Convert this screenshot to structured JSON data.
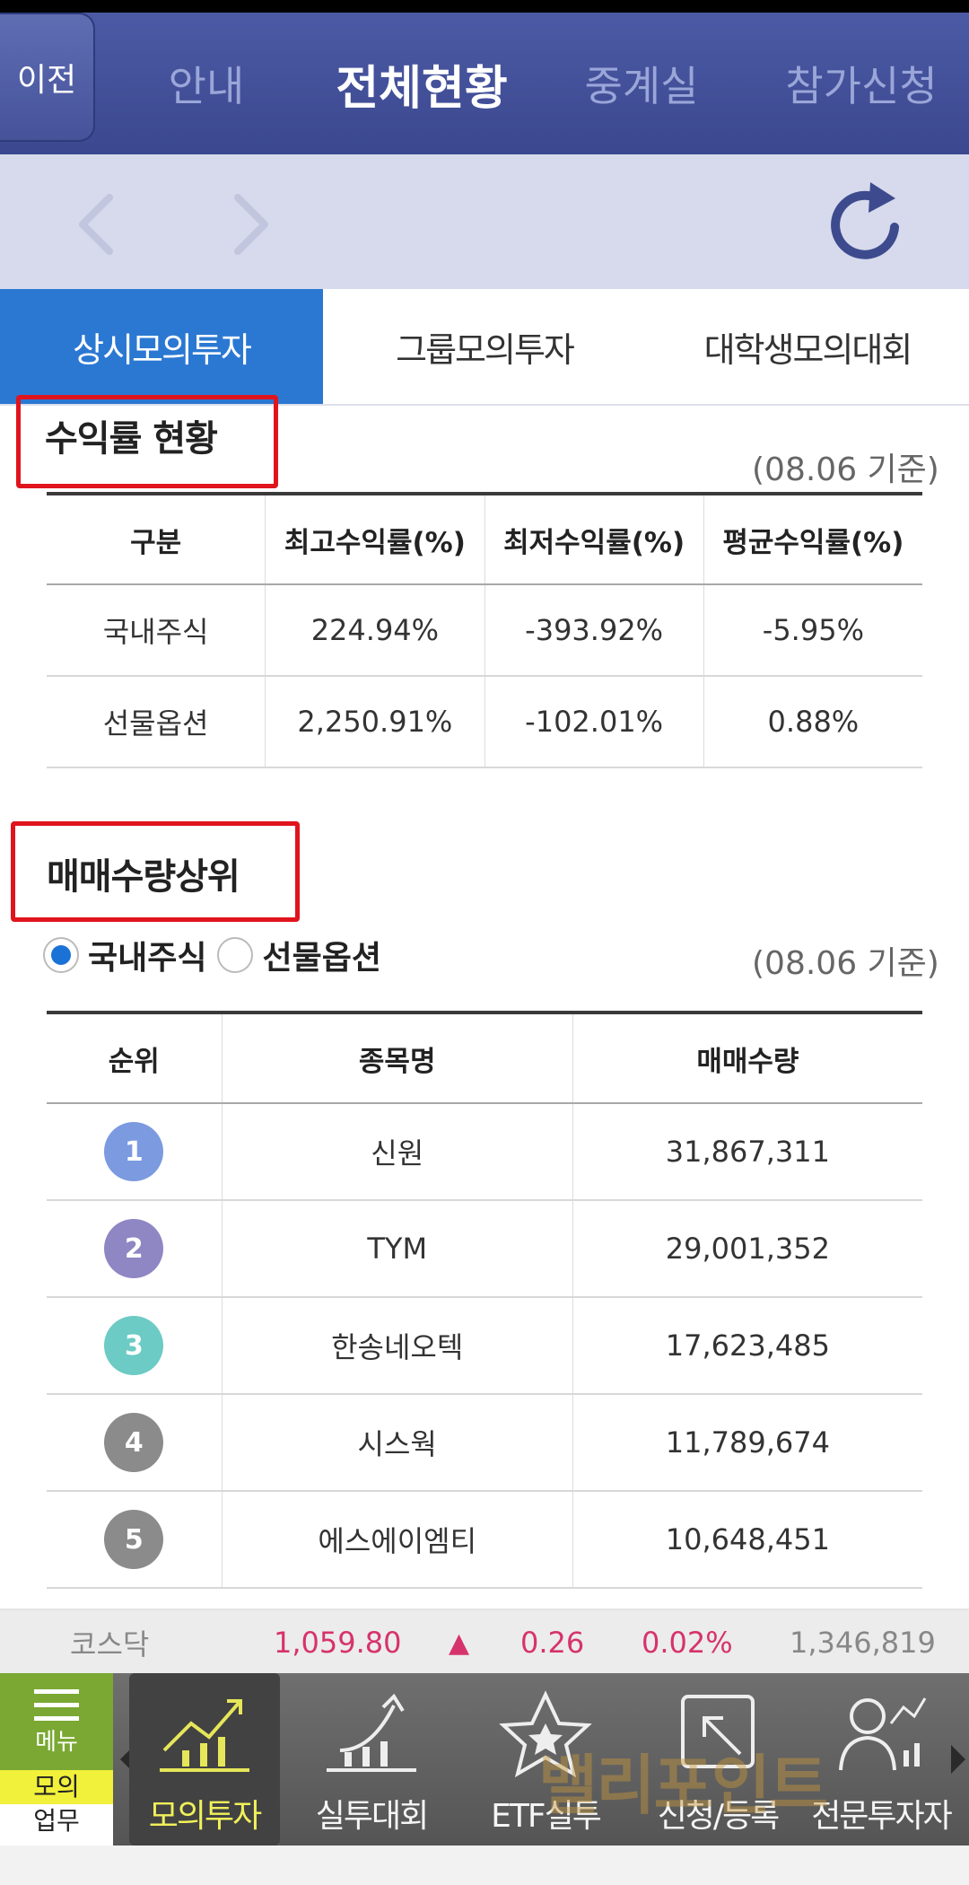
{
  "topnav": {
    "back_label": "이전",
    "tabs": [
      {
        "label": "안내"
      },
      {
        "label": "전체현황"
      },
      {
        "label": "중계실"
      },
      {
        "label": "참가신청"
      }
    ]
  },
  "subtabs": [
    {
      "label": "상시모의투자"
    },
    {
      "label": "그룹모의투자"
    },
    {
      "label": "대학생모의대회"
    }
  ],
  "returns": {
    "title": "수익률 현황",
    "basis": "(08.06 기준)",
    "headers": [
      "구분",
      "최고수익률(%)",
      "최저수익률(%)",
      "평균수익률(%)"
    ],
    "rows": [
      [
        "국내주식",
        "224.94%",
        "-393.92%",
        "-5.95%"
      ],
      [
        "선물옵션",
        "2,250.91%",
        "-102.01%",
        "0.88%"
      ]
    ]
  },
  "volume": {
    "title": "매매수량상위",
    "basis": "(08.06 기준)",
    "radio": [
      {
        "label": "국내주식",
        "selected": true
      },
      {
        "label": "선물옵션",
        "selected": false
      }
    ],
    "headers": [
      "순위",
      "종목명",
      "매매수량"
    ],
    "rows": [
      {
        "rank": "1",
        "name": "신원",
        "qty": "31,867,311",
        "color": "#7b9ae0"
      },
      {
        "rank": "2",
        "name": "TYM",
        "qty": "29,001,352",
        "color": "#8f86c4"
      },
      {
        "rank": "3",
        "name": "한송네오텍",
        "qty": "17,623,485",
        "color": "#6ccbc4"
      },
      {
        "rank": "4",
        "name": "시스웍",
        "qty": "11,789,674",
        "color": "#8b8b8b"
      },
      {
        "rank": "5",
        "name": "에스에이엠티",
        "qty": "10,648,451",
        "color": "#8b8b8b"
      }
    ]
  },
  "ticker": {
    "name": "코스닥",
    "index": "1,059.80",
    "arrow": "▲",
    "change": "0.26",
    "percent": "0.02%",
    "volume": "1,346,819",
    "up_color": "#d6336c"
  },
  "bottom_nav": {
    "menu_label": "메뉴",
    "mode_top": "모의",
    "mode_bottom": "업무",
    "items": [
      {
        "label": "모의투자",
        "icon": "chart-up-icon"
      },
      {
        "label": "실투대회",
        "icon": "growth-arrow-icon"
      },
      {
        "label": "ETF실투",
        "icon": "star-badge-icon"
      },
      {
        "label": "신청/등록",
        "icon": "signup-icon"
      },
      {
        "label": "전문투자자",
        "icon": "investor-icon"
      }
    ],
    "watermark": "밸리포인트"
  }
}
